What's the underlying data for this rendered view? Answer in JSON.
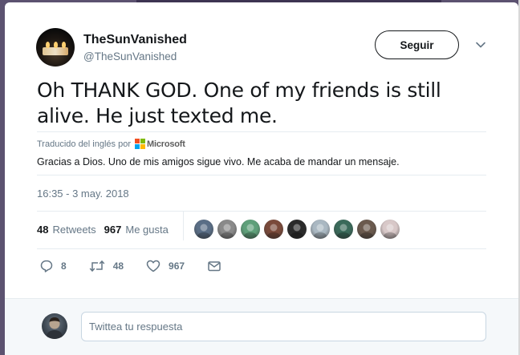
{
  "tweet": {
    "author": {
      "display_name": "TheSunVanished",
      "handle": "@TheSunVanished"
    },
    "follow_label": "Seguir",
    "text": "Oh THANK GOD. One of my friends is still alive. He just texted me.",
    "translation": {
      "prefix": "Traducido del inglés por",
      "provider": "Microsoft",
      "text": "Gracias a Dios. Uno de mis amigos sigue vivo. Me acaba de mandar un mensaje."
    },
    "timestamp": "16:35 - 3 may. 2018",
    "stats": {
      "retweets_count": "48",
      "retweets_label": "Retweets",
      "likes_count": "967",
      "likes_label": "Me gusta"
    },
    "likers": [
      {
        "icon": "avatar-icon",
        "color": "#5a6e86"
      },
      {
        "icon": "avatar-icon",
        "color": "#8a8a8a"
      },
      {
        "icon": "avatar-icon",
        "color": "#5fa07a"
      },
      {
        "icon": "avatar-icon",
        "color": "#7a4a3a"
      },
      {
        "icon": "avatar-icon",
        "color": "#2a2a2a"
      },
      {
        "icon": "avatar-icon",
        "color": "#aab8c2"
      },
      {
        "icon": "avatar-icon",
        "color": "#3a6a5a"
      },
      {
        "icon": "avatar-icon",
        "color": "#6b5a4e"
      },
      {
        "icon": "avatar-icon",
        "color": "#d8c8c8"
      }
    ],
    "actions": {
      "reply_count": "8",
      "retweet_count": "48",
      "like_count": "967"
    }
  },
  "reply": {
    "placeholder": "Twittea tu respuesta"
  },
  "colors": {
    "text_primary": "#14171a",
    "text_secondary": "#657786",
    "divider": "#e6ecf0",
    "backdrop": "#5c5270"
  }
}
